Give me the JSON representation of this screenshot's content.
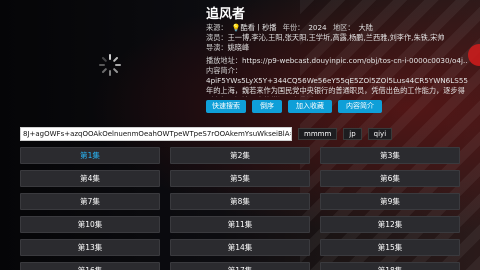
{
  "title": "追风者",
  "source_label": "来源：",
  "source_value": "💡酷看丨秒播",
  "year_label": "年份：",
  "year_value": "2024",
  "region_label": "地区：",
  "region_value": "大陆",
  "actors_label": "演员：",
  "actors_value": "王一博,李沁,王阳,张天阳,王学圻,高露,杨鹏,兰西雅,刘李作,朱铁,宋帅",
  "director_label": "导演：",
  "director_value": "姚晓峰",
  "play_label": "播放地址：",
  "play_value": "https://p9-webcast.douyinpic.com/obj/tos-cn-i-0000c0030/o4j...",
  "content_label": "内容简介：",
  "content_value": "4piF5YWs5LyX5Y+344CQ56We56eY55qE5ZOl5ZOl5Lus44CR5YWN6LS55YiG5Lqr77ya1930年的上海，魏若来作为国民党中央银行的普通职员，凭借出色的工作能力，逐步得到高级顾问沈图南的赏识。在此过...",
  "buttons": [
    "快速搜索",
    "倒序",
    "加入收藏",
    "内容简介"
  ],
  "search_value": "8J+agOWFs+azqOOAkOelnuenmOeahOWTpeWTpeS7rOOAkemYsuWkseiBlA==",
  "chips": [
    "mmmm",
    "jp",
    "qiyi"
  ],
  "episodes": [
    "第1集",
    "第2集",
    "第3集",
    "第4集",
    "第5集",
    "第6集",
    "第7集",
    "第8集",
    "第9集",
    "第10集",
    "第11集",
    "第12集",
    "第13集",
    "第14集",
    "第15集",
    "第16集",
    "第17集",
    "第18集"
  ],
  "active_episode_index": 0,
  "colors": {
    "accent": "#0f9fd8",
    "active_text": "#29b6f6",
    "tile_bg": "#2b2b2f"
  }
}
